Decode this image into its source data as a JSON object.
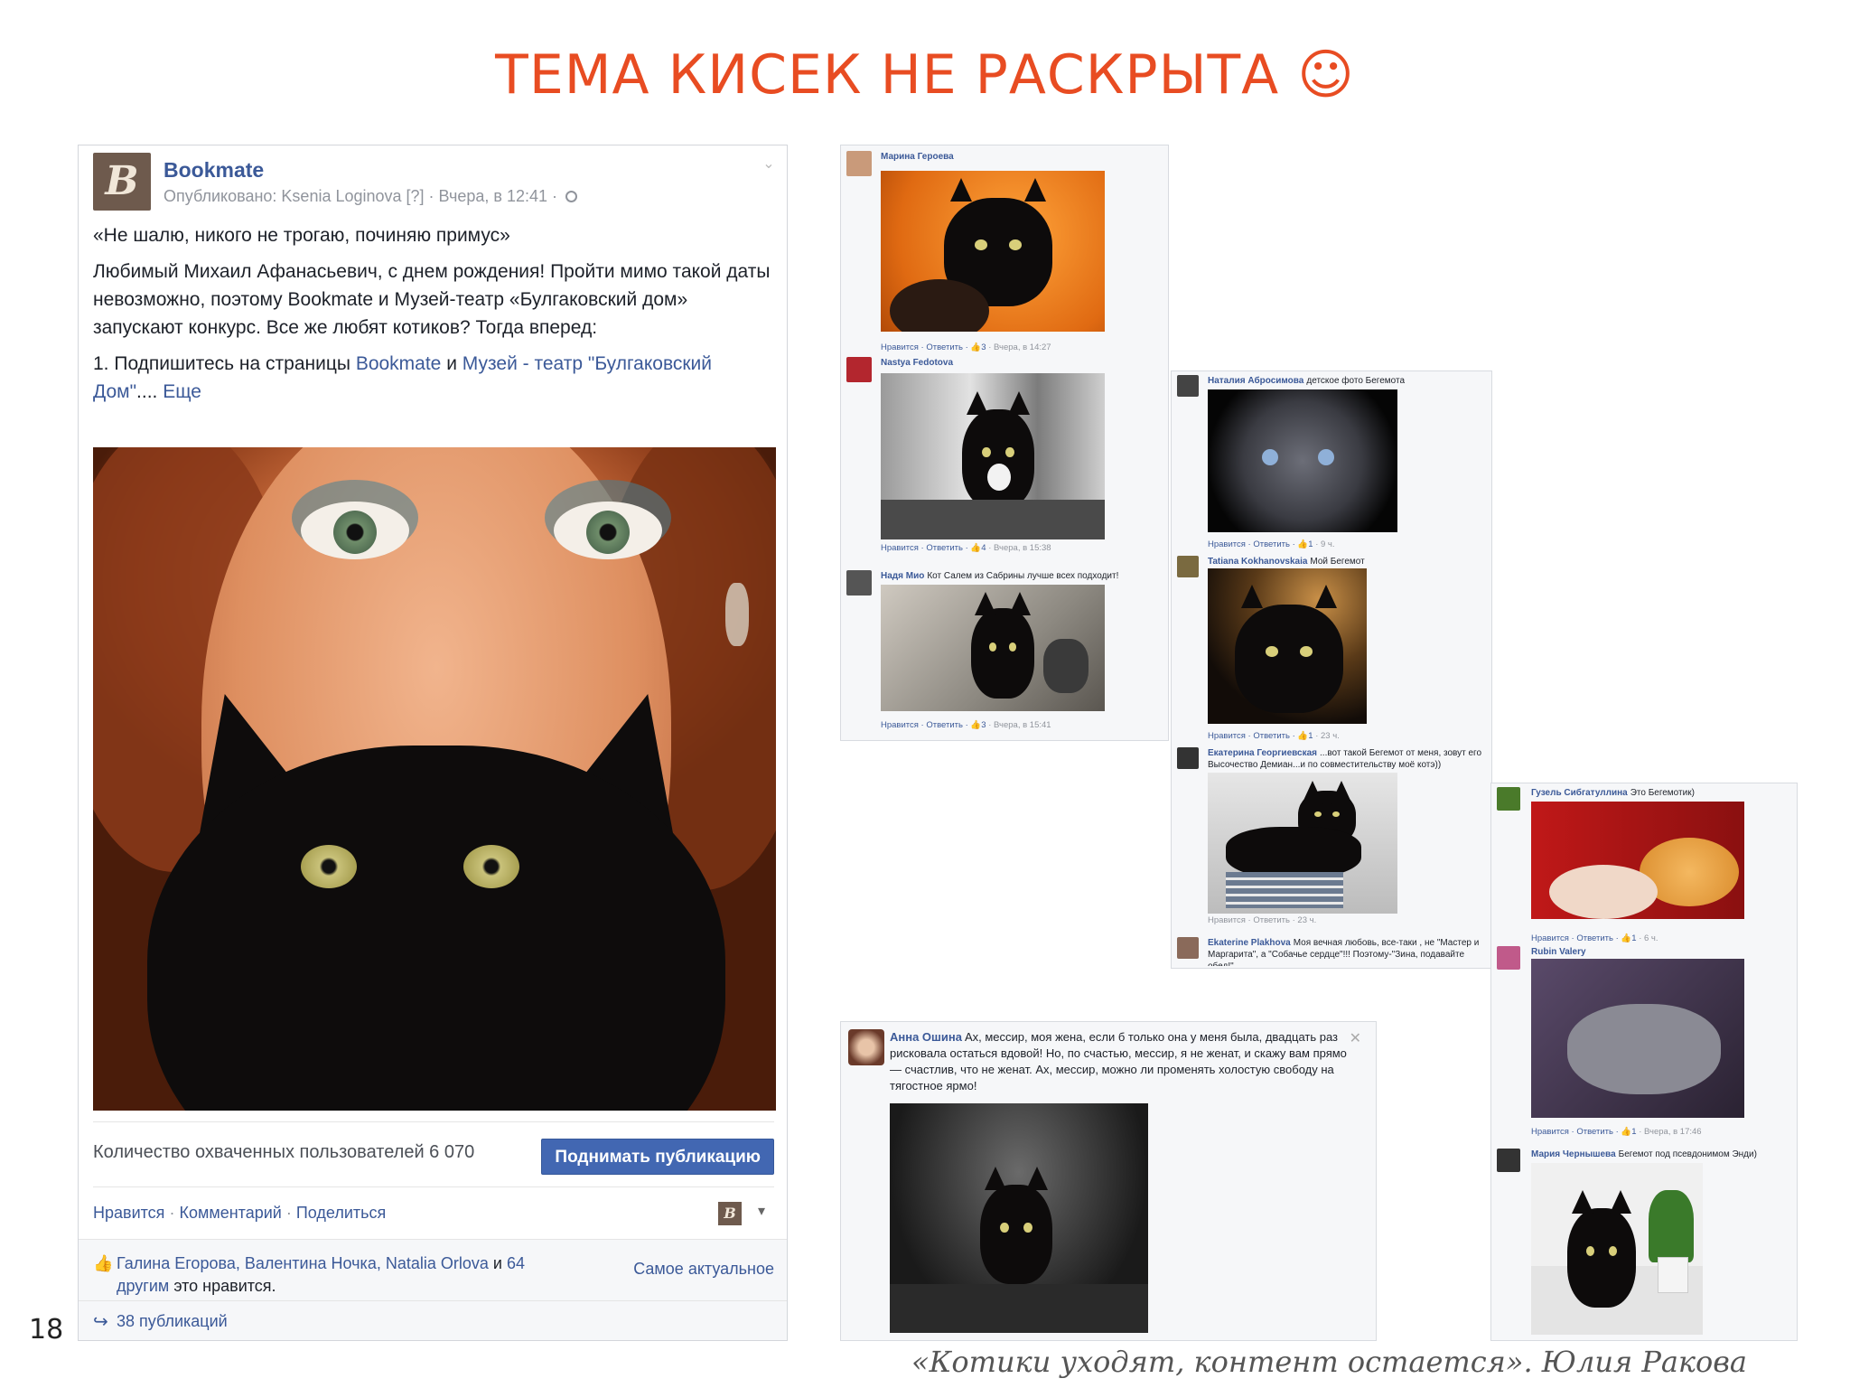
{
  "slide": {
    "title": "ТЕМА КИСЕК НЕ РАСКРЫТА ☺",
    "page_number": "18",
    "caption": "«Котики уходят, контент остается». Юлия Ракова"
  },
  "post": {
    "page_name": "Bookmate",
    "logo_glyph": "B",
    "published_prefix": "Опубликовано: Ksenia Loginova",
    "published_suffix": "[?] · Вчера, в 12:41 ·",
    "quote": "«Не шалю, никого не трогаю, починяю примус»",
    "paragraph": "Любимый Михаил Афанасьевич, с днем рождения! Пройти мимо такой даты невозможно, поэтому Bookmate и Музей-театр «Булгаковский дом» запускают конкурс. Все же любят котиков? Тогда вперед:",
    "step_prefix": "1. Подпишитесь на страницы",
    "link_bookmate": "Bookmate",
    "and_word": "и",
    "link_museum": "Музей - театр \"Булгаковский Дом\"",
    "ellipsis": "....",
    "more_link": "Еще",
    "reach_text": "Количество охваченных пользователей 6 070",
    "boost_label": "Поднимать публикацию",
    "action_like": "Нравится",
    "action_comment": "Комментарий",
    "action_share": "Поделиться",
    "likes_names": "Галина Егорова, Валентина Ночка, Natalia Orlova",
    "likes_and": "и",
    "likes_others": "64 другим",
    "likes_suffix": "это нравится.",
    "sort_label": "Самое актуальное",
    "shares_text": "38 публикаций"
  },
  "panel1": {
    "c1": {
      "name": "Марина Героева",
      "text": "",
      "footer": "Нравится · Ответить · ",
      "likes": "3",
      "time": " · Вчера, в 14:27"
    },
    "c2": {
      "name": "Nastya Fedotova",
      "text": "",
      "footer": "Нравится · Ответить · ",
      "likes": "4",
      "time": " · Вчера, в 15:38"
    },
    "c3": {
      "name": "Надя Мио",
      "text": "Кот Салем из Сабрины лучше всех подходит!",
      "footer": "Нравится · Ответить · ",
      "likes": "3",
      "time": " · Вчера, в 15:41"
    }
  },
  "panel2": {
    "c1": {
      "name": "Наталия Абросимова",
      "text": "детское фото Бегемота",
      "footer": "Нравится · Ответить · ",
      "likes": "1",
      "time": " · 9 ч."
    },
    "c2": {
      "name": "Tatiana Kokhanovskaia",
      "text": "Мой Бегемот",
      "footer": "Нравится · Ответить · ",
      "likes": "1",
      "time": " · 23 ч."
    },
    "c3": {
      "name": "Екатерина Георгиевская",
      "text": "...вот такой Бегемот от меня, зовут его Высочество Демиан...и по совместительству моё котэ))",
      "footer": "Нравится · Ответить · 23 ч."
    },
    "c4": {
      "name": "Ekaterine Plakhova",
      "text": "Моя вечная любовь, все-таки , не \"Мастер и Маргарита\", а \"Собачье сердце\"!!! Поэтому-\"Зина, подавайте обед!\""
    }
  },
  "panel3": {
    "c1": {
      "name": "Гузель Сибгатуллина",
      "text": "Это Бегемотик)",
      "footer": "Нравится · Ответить · ",
      "likes": "1",
      "time": " · 6 ч."
    },
    "c2": {
      "name": "Rubin Valery",
      "text": "",
      "footer": "Нравится · Ответить · ",
      "likes": "1",
      "time": " · Вчера, в 17:46"
    },
    "c3": {
      "name": "Мария Чернышева",
      "text": "Бегемот под псевдонимом Энди)"
    }
  },
  "panel4": {
    "name": "Анна Ошина",
    "text": "Ах, мессир, моя жена, если б только она у меня была, двадцать раз рисковала остаться вдовой! Но, по счастью, мессир, я не женат, и скажу вам прямо — счастлив, что не женат. Ах, мессир, можно ли променять холостую свободу на тягостное ярмо!"
  },
  "icons": {
    "thumb": "👍",
    "share": "↪",
    "close": "✕",
    "caret": "▾",
    "chevron": "⌄"
  },
  "colors": {
    "title": "#e84c22",
    "link": "#3b5998",
    "boost": "#4267b2"
  }
}
